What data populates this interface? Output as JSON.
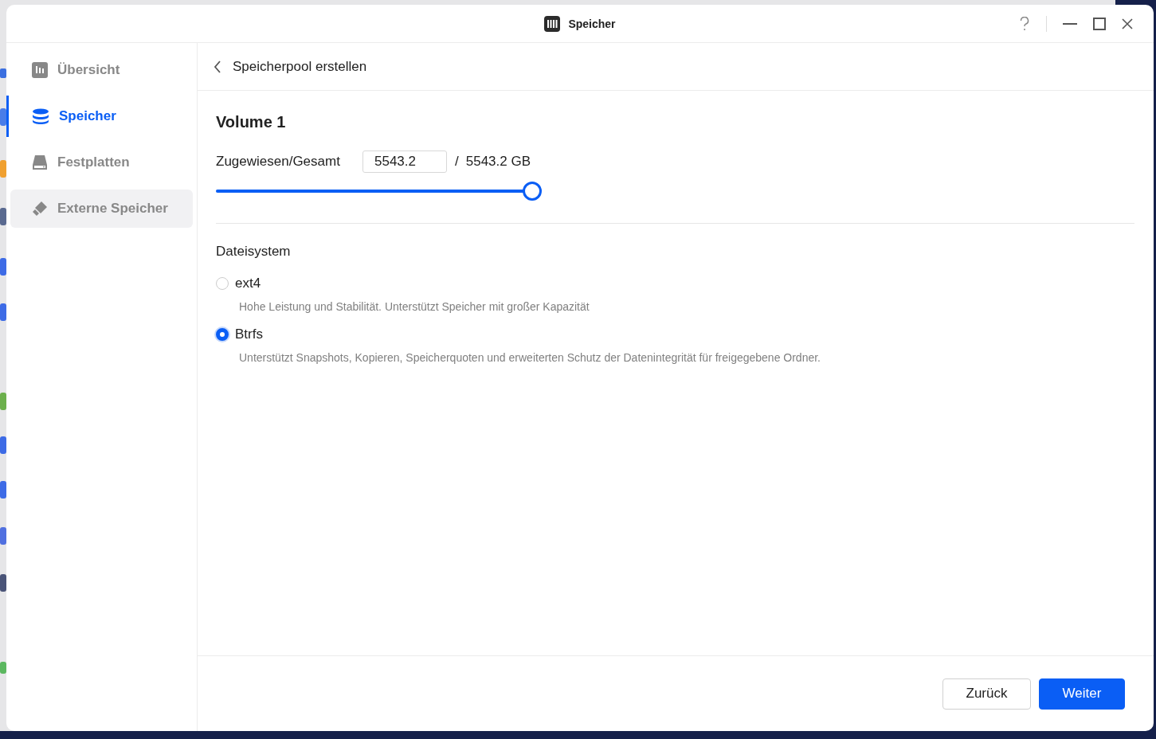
{
  "window": {
    "title": "Speicher"
  },
  "sidebar": {
    "items": [
      {
        "label": "Übersicht",
        "selected": false,
        "hovered": false
      },
      {
        "label": "Speicher",
        "selected": true,
        "hovered": false
      },
      {
        "label": "Festplatten",
        "selected": false,
        "hovered": false
      },
      {
        "label": "Externe Speicher",
        "selected": false,
        "hovered": true
      }
    ]
  },
  "header": {
    "title": "Speicherpool erstellen"
  },
  "volume": {
    "title": "Volume 1",
    "allocated_label": "Zugewiesen/Gesamt",
    "value": "5543.2",
    "separator": "/",
    "total": "5543.2 GB",
    "level": 1
  },
  "filesystem": {
    "label": "Dateisystem",
    "options": [
      {
        "label": "ext4",
        "description": "Hohe Leistung und Stabilität. Unterstützt Speicher mit großer Kapazität",
        "selected": false
      },
      {
        "label": "Btrfs",
        "description": "Unterstützt Snapshots, Kopieren, Speicherquoten und erweiterten Schutz der Datenintegrität für freigegebene Ordner.",
        "selected": true
      }
    ]
  },
  "buttons": [
    {
      "label": "Zurück",
      "kind": "secondary"
    },
    {
      "label": "Weiter",
      "kind": "primary"
    }
  ]
}
